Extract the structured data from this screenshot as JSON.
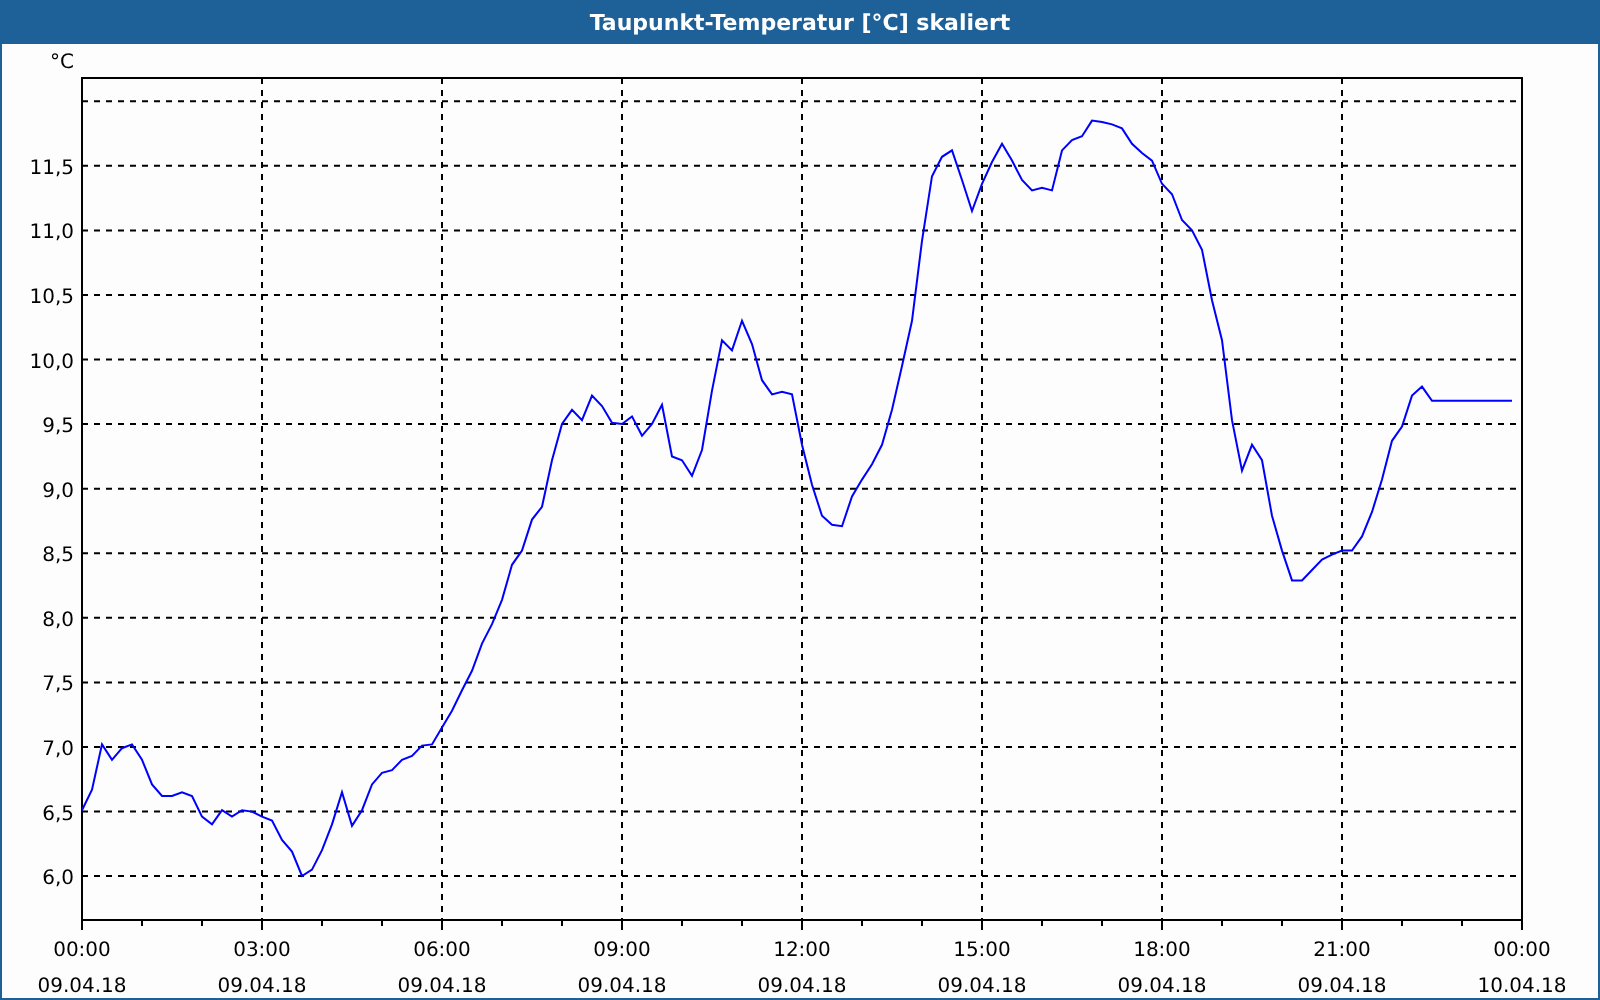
{
  "window": {
    "title": "Taupunkt-Temperatur [°C] skaliert"
  },
  "chart": {
    "chart_data": {
      "type": "line",
      "grid": true,
      "ylabel": "°C",
      "ylim": [
        5.66,
        12.18
      ],
      "categories": [
        "00:00\n09.04.18",
        null,
        null,
        null,
        null,
        null,
        null,
        null,
        null,
        null,
        null,
        null,
        null,
        null,
        null,
        null,
        null,
        null,
        "03:00\n09.04.18",
        null,
        null,
        null,
        null,
        null,
        null,
        null,
        null,
        null,
        null,
        null,
        null,
        null,
        null,
        null,
        null,
        null,
        "06:00\n09.04.18",
        null,
        null,
        null,
        null,
        null,
        null,
        null,
        null,
        null,
        null,
        null,
        null,
        null,
        null,
        null,
        null,
        null,
        "09:00\n09.04.18",
        null,
        null,
        null,
        null,
        null,
        null,
        null,
        null,
        null,
        null,
        null,
        null,
        null,
        null,
        null,
        null,
        null,
        "12:00\n09.04.18",
        null,
        null,
        null,
        null,
        null,
        null,
        null,
        null,
        null,
        null,
        null,
        null,
        null,
        null,
        null,
        null,
        null,
        "15:00\n09.04.18",
        null,
        null,
        null,
        null,
        null,
        null,
        null,
        null,
        null,
        null,
        null,
        null,
        null,
        null,
        null,
        null,
        null,
        "18:00\n09.04.18",
        null,
        null,
        null,
        null,
        null,
        null,
        null,
        null,
        null,
        null,
        null,
        null,
        null,
        null,
        null,
        null,
        null,
        "21:00\n09.04.18",
        null,
        null,
        null,
        null,
        null,
        null,
        null,
        null,
        null,
        null,
        null,
        null,
        null,
        null,
        null,
        null,
        null,
        "00:00\n10.04.18"
      ],
      "yticks": [
        {
          "value": 6,
          "label": "6,0"
        },
        {
          "value": 6.5,
          "label": "6,5"
        },
        {
          "value": 7,
          "label": "7,0"
        },
        {
          "value": 7.5,
          "label": "7,5"
        },
        {
          "value": 8,
          "label": "8,0"
        },
        {
          "value": 8.5,
          "label": "8,5"
        },
        {
          "value": 9,
          "label": "9,0"
        },
        {
          "value": 9.5,
          "label": "9,5"
        },
        {
          "value": 10,
          "label": "10,0"
        },
        {
          "value": 10.5,
          "label": "10,5"
        },
        {
          "value": 11,
          "label": "11,0"
        },
        {
          "value": 11.5,
          "label": "11,5"
        }
      ],
      "series": [
        {
          "color": "#0000ff",
          "values": [
            6.51,
            6.67,
            7.02,
            6.9,
            6.99,
            7.02,
            6.9,
            6.71,
            6.62,
            6.62,
            6.65,
            6.62,
            6.46,
            6.4,
            6.51,
            6.46,
            6.51,
            6.5,
            6.46,
            6.43,
            6.28,
            6.19,
            6.0,
            6.05,
            6.2,
            6.4,
            6.65,
            6.39,
            6.51,
            6.71,
            6.8,
            6.82,
            6.9,
            6.93,
            7.01,
            7.02,
            7.15,
            7.28,
            7.44,
            7.59,
            7.8,
            7.95,
            8.14,
            8.41,
            8.52,
            8.76,
            8.86,
            9.22,
            9.5,
            9.61,
            9.53,
            9.72,
            9.64,
            9.51,
            9.5,
            9.56,
            9.41,
            9.5,
            9.65,
            9.25,
            9.22,
            9.1,
            9.3,
            9.76,
            10.15,
            10.07,
            10.3,
            10.12,
            9.84,
            9.73,
            9.75,
            9.73,
            9.34,
            9.03,
            8.79,
            8.72,
            8.71,
            8.94,
            9.07,
            9.19,
            9.34,
            9.61,
            9.95,
            10.3,
            10.92,
            11.42,
            11.57,
            11.62,
            11.39,
            11.15,
            11.36,
            11.53,
            11.67,
            11.54,
            11.39,
            11.31,
            11.33,
            11.31,
            11.62,
            11.7,
            11.73,
            11.85,
            11.84,
            11.82,
            11.79,
            11.67,
            11.6,
            11.54,
            11.36,
            11.28,
            11.08,
            11.0,
            10.85,
            10.46,
            10.15,
            9.53,
            9.14,
            9.34,
            9.22,
            8.79,
            8.52,
            8.29,
            8.29,
            8.37,
            8.45,
            8.49,
            8.52,
            8.52,
            8.63,
            8.82,
            9.07,
            9.37,
            9.48,
            9.72,
            9.79,
            9.68,
            9.68,
            9.68,
            9.68,
            9.68,
            9.68,
            9.68,
            9.68,
            9.68,
            null
          ]
        }
      ]
    }
  }
}
